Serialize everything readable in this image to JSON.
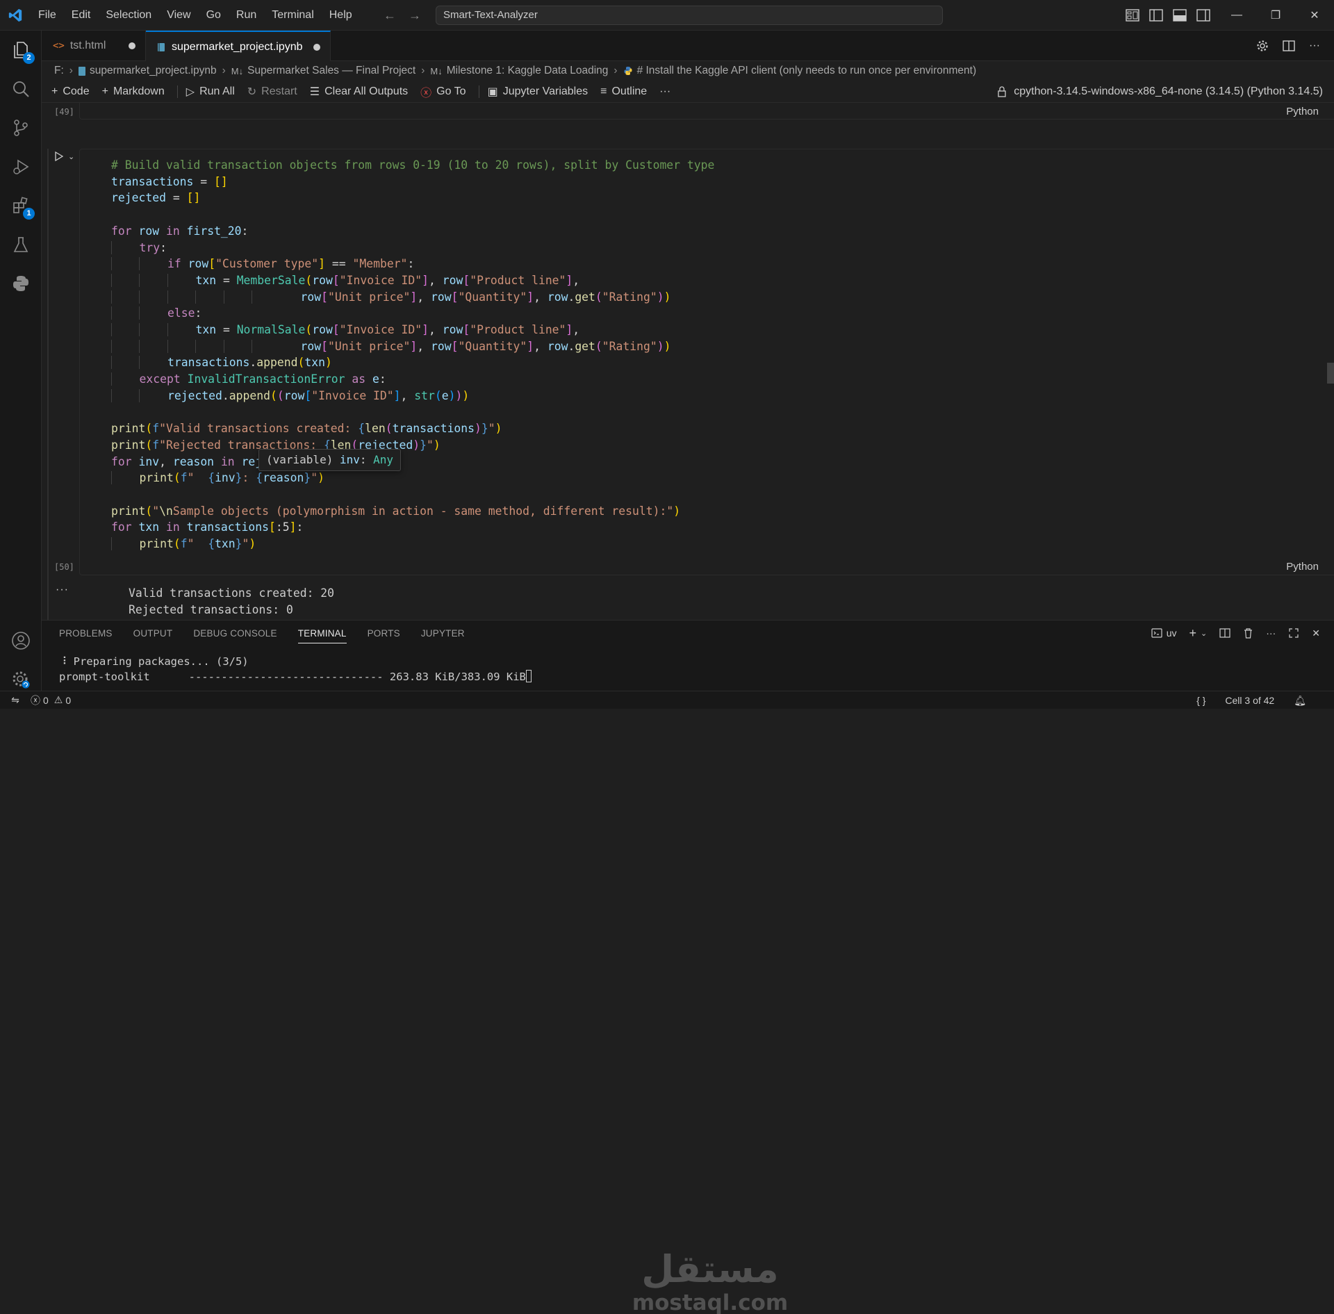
{
  "titlebar": {
    "menu": [
      "File",
      "Edit",
      "Selection",
      "View",
      "Go",
      "Run",
      "Terminal",
      "Help"
    ],
    "search_text": "Smart-Text-Analyzer"
  },
  "activity": {
    "explorer_badge": "2",
    "extensions_badge": "1"
  },
  "tabs": [
    {
      "label": "tst.html",
      "modified": true
    },
    {
      "label": "supermarket_project.ipynb",
      "modified": true,
      "active": true
    }
  ],
  "breadcrumb": {
    "drive": "F:",
    "file": "supermarket_project.ipynb",
    "section1": "Supermarket Sales — Final Project",
    "section2": "Milestone 1: Kaggle Data Loading",
    "cell": "# Install the Kaggle API client (only needs to run once per environment)"
  },
  "toolbar": {
    "code": "Code",
    "markdown": "Markdown",
    "run_all": "Run All",
    "restart": "Restart",
    "clear_outputs": "Clear All Outputs",
    "go_to": "Go To",
    "variables": "Jupyter Variables",
    "outline": "Outline",
    "more": "···",
    "kernel": "cpython-3.14.5-windows-x86_64-none (3.14.5) (Python 3.14.5)"
  },
  "cells": {
    "prev_exec": "[49]",
    "prev_lang": "Python",
    "exec": "[50]",
    "lang": "Python",
    "hover_label": "(variable)",
    "hover_var": "inv",
    "hover_type": "Any",
    "output_dots": "···",
    "output": [
      "Valid transactions created: 20",
      "Rejected transactions: 0"
    ]
  },
  "panel": {
    "tabs": [
      "PROBLEMS",
      "OUTPUT",
      "DEBUG CONSOLE",
      "TERMINAL",
      "PORTS",
      "JUPYTER"
    ],
    "active_tab": "TERMINAL",
    "terminal_name": "uv",
    "terminal_line1": "⠸ Preparing packages... (3/5)",
    "terminal_line2": "prompt-toolkit      ------------------------------ 263.83 KiB/383.09 KiB"
  },
  "watermark": {
    "arabic": "مستقل",
    "latin": "mostaql.com"
  },
  "status": {
    "errors": "0",
    "warnings": "0",
    "braces": "{ }",
    "cell_pos": "Cell 3 of 42"
  },
  "colors": {
    "accent": "#0078d4",
    "background": "#1f1f1f"
  }
}
